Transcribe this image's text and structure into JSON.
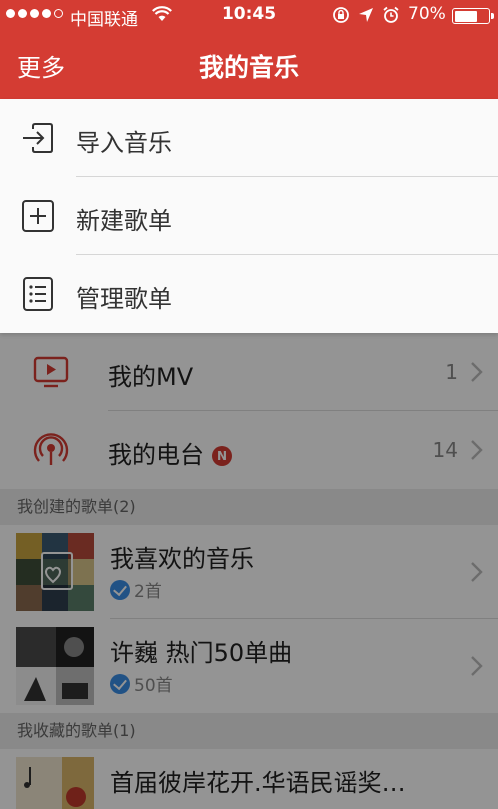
{
  "status_bar": {
    "carrier": "中国联通",
    "time": "10:45",
    "battery_pct": "70%",
    "battery_level": 0.7
  },
  "header": {
    "left_label": "更多",
    "title": "我的音乐",
    "bg_color": "#d43c33"
  },
  "menu": {
    "items": [
      {
        "label": "导入音乐",
        "icon": "import-icon"
      },
      {
        "label": "新建歌单",
        "icon": "plus-square-icon"
      },
      {
        "label": "管理歌单",
        "icon": "list-icon"
      }
    ]
  },
  "rows": [
    {
      "label": "我的MV",
      "count": "1",
      "icon": "mv-icon"
    },
    {
      "label": "我的电台",
      "badge": "N",
      "count": "14",
      "icon": "radio-icon"
    }
  ],
  "sections": {
    "created": "我创建的歌单(2)",
    "collected": "我收藏的歌单(1)"
  },
  "playlists_created": [
    {
      "title": "我喜欢的音乐",
      "sub": "2首"
    },
    {
      "title": "许巍 热门50单曲",
      "sub": "50首"
    }
  ],
  "playlists_collected": [
    {
      "title": "首届彼岸花开.华语民谣奖…"
    }
  ]
}
